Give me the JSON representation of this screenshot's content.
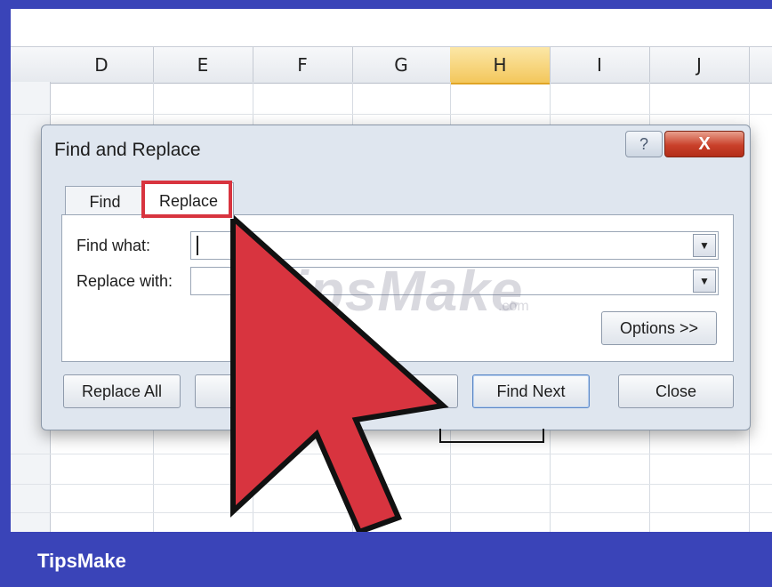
{
  "spreadsheet": {
    "columns": [
      "D",
      "E",
      "F",
      "G",
      "H",
      "I",
      "J"
    ],
    "selected_column": "H"
  },
  "dialog": {
    "title": "Find and Replace",
    "help_icon": "help-icon",
    "close_label": "X",
    "tabs": [
      {
        "label": "Find",
        "active": false
      },
      {
        "label": "Replace",
        "active": true
      }
    ],
    "find_what_label": "Find what:",
    "find_what_value": "",
    "replace_with_label": "Replace with:",
    "replace_with_value": "",
    "options_button": "Options >>",
    "buttons": {
      "replace_all": "Replace All",
      "find_next": "Find Next",
      "close": "Close"
    }
  },
  "watermark": {
    "text": "TipsMake",
    "suffix": ".com"
  },
  "brand": {
    "text": "TipsMake"
  },
  "colors": {
    "frame_blue": "#3a44b8",
    "highlight_red": "#d8343f",
    "arrow_red": "#d8343f",
    "selected_column": "#f3c75c"
  }
}
